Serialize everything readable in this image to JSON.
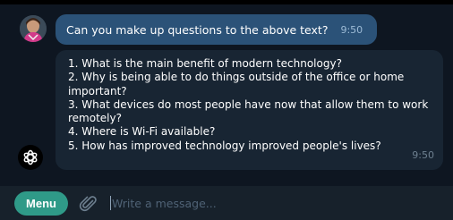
{
  "conversation": {
    "outgoing": {
      "text": "Can you make up questions to the above text?",
      "time": "9:50",
      "status_icon": "double-check-icon"
    },
    "incoming": {
      "lines": [
        "1. What is the main benefit of modern technology?",
        "2. Why is being able to do things outside of the office or home",
        "important?",
        "3. What devices do most people have now that allow them to work",
        "remotely?",
        "4. Where is Wi-Fi available?",
        "5. How has improved technology improved people's lives?"
      ],
      "time": "9:50",
      "sender_icon": "openai-logo-icon"
    }
  },
  "composer": {
    "menu_label": "Menu",
    "attach_icon": "paperclip-icon",
    "placeholder": "Write a message..."
  },
  "colors": {
    "background": "#0e1621",
    "outgoing_bubble": "#2b5278",
    "incoming_bubble": "#182533",
    "composer": "#17212b",
    "menu_button": "#2f9a88",
    "read_ticks": "#5eb5f7"
  }
}
